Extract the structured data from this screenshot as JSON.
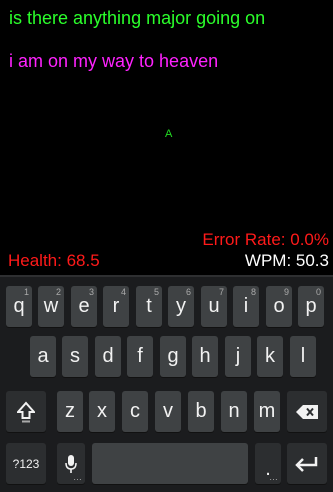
{
  "colors": {
    "target": "#2bff2b",
    "typed": "#ff22ff",
    "marker": "#22dd22",
    "error": "#ff1a1a",
    "health": "#ff1a1a",
    "wpm": "#ffffff"
  },
  "game": {
    "target_text": "is there anything major going on",
    "typed_text": "i am on my way to heaven",
    "marker": "A",
    "error_rate": "Error Rate: 0.0%",
    "health": "Health: 68.5",
    "wpm": "WPM: 50.3"
  },
  "keyboard": {
    "row1": [
      {
        "label": "q",
        "hint": "1"
      },
      {
        "label": "w",
        "hint": "2"
      },
      {
        "label": "e",
        "hint": "3"
      },
      {
        "label": "r",
        "hint": "4"
      },
      {
        "label": "t",
        "hint": "5"
      },
      {
        "label": "y",
        "hint": "6"
      },
      {
        "label": "u",
        "hint": "7"
      },
      {
        "label": "i",
        "hint": "8"
      },
      {
        "label": "o",
        "hint": "9"
      },
      {
        "label": "p",
        "hint": "0"
      }
    ],
    "row2": [
      "a",
      "s",
      "d",
      "f",
      "g",
      "h",
      "j",
      "k",
      "l"
    ],
    "row3": [
      "z",
      "x",
      "c",
      "v",
      "b",
      "n",
      "m"
    ],
    "symbols_label": "?123",
    "period_label": ".",
    "icons": {
      "shift": "shift-icon",
      "backspace": "backspace-icon",
      "mic": "microphone-icon",
      "enter": "enter-icon"
    }
  }
}
